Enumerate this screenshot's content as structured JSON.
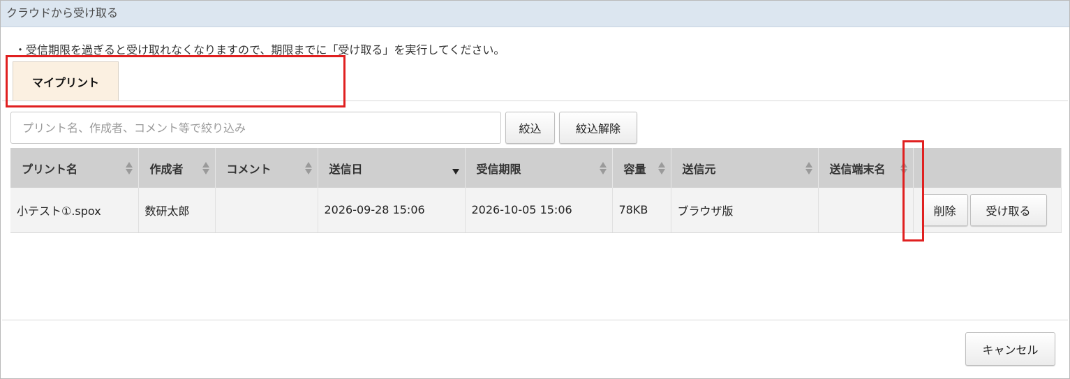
{
  "dialog": {
    "title": "クラウドから受け取る",
    "notice": "・受信期限を過ぎると受け取れなくなりますので、期限までに「受け取る」を実行してください。"
  },
  "tabs": [
    {
      "label": "マイプリント"
    }
  ],
  "filter": {
    "placeholder": "プリント名、作成者、コメント等で絞り込み",
    "value": "",
    "apply_label": "絞込",
    "clear_label": "絞込解除"
  },
  "table": {
    "columns": [
      {
        "label": "プリント名",
        "sort": "none"
      },
      {
        "label": "作成者",
        "sort": "none"
      },
      {
        "label": "コメント",
        "sort": "none"
      },
      {
        "label": "送信日",
        "sort": "desc"
      },
      {
        "label": "受信期限",
        "sort": "none"
      },
      {
        "label": "容量",
        "sort": "none"
      },
      {
        "label": "送信元",
        "sort": "none"
      },
      {
        "label": "送信端末名",
        "sort": "none"
      },
      {
        "label": "",
        "sort": "none"
      }
    ],
    "rows": [
      {
        "name": "小テスト①.spox",
        "author": "数研太郎",
        "comment": "",
        "sent_date": "2026-09-28 15:06",
        "expiry": "2026-10-05 15:06",
        "size": "78KB",
        "source": "ブラウザ版",
        "device": "",
        "delete_label": "削除",
        "receive_label": "受け取る"
      }
    ]
  },
  "footer": {
    "cancel_label": "キャンセル"
  },
  "colors": {
    "titlebar": "#dce6f0",
    "tab": "#fbf0e1",
    "highlight": "#e02020",
    "header": "#cfcfcf"
  }
}
